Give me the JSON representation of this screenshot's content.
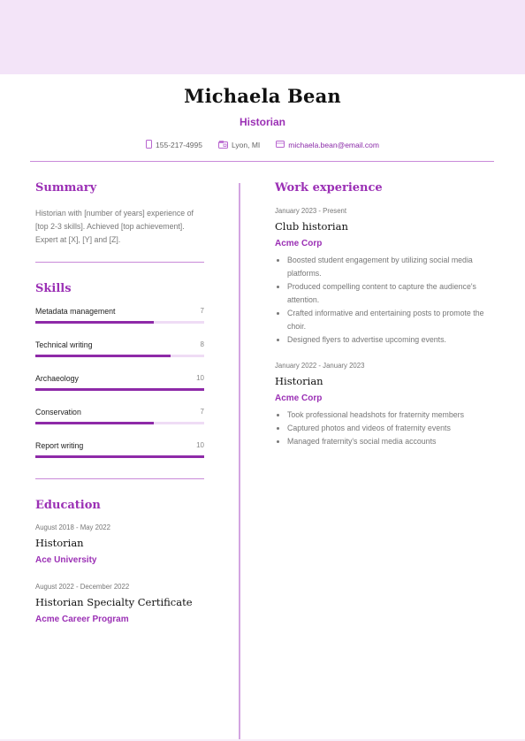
{
  "header": {
    "name": "Michaela Bean",
    "title": "Historian",
    "contacts": [
      {
        "icon": "phone-icon",
        "text": "155-217-4995"
      },
      {
        "icon": "location-card-icon",
        "text": "Lyon, MI"
      },
      {
        "icon": "email-icon",
        "text": "michaela.bean@email.com"
      }
    ]
  },
  "summary": {
    "heading": "Summary",
    "text": "Historian with [number of years] experience of [top 2-3 skills]. Achieved [top achievement]. Expert at [X], [Y] and [Z]."
  },
  "skills": {
    "heading": "Skills",
    "max": 10,
    "items": [
      {
        "name": "Metadata management",
        "level": 7
      },
      {
        "name": "Technical writing",
        "level": 8
      },
      {
        "name": "Archaeology",
        "level": 10
      },
      {
        "name": "Conservation",
        "level": 7
      },
      {
        "name": "Report writing",
        "level": 10
      }
    ]
  },
  "education": {
    "heading": "Education",
    "items": [
      {
        "dates": "August 2018 - May 2022",
        "degree": "Historian",
        "school": "Ace University"
      },
      {
        "dates": "August 2022 - December 2022",
        "degree": "Historian Specialty Certificate",
        "school": "Acme Career Program"
      }
    ]
  },
  "work": {
    "heading": "Work experience",
    "items": [
      {
        "dates": "January 2023 - Present",
        "role": "Club historian",
        "company": "Acme Corp",
        "bullets": [
          "Boosted student engagement by utilizing social media platforms.",
          "Produced compelling content to capture the audience's attention.",
          "Crafted informative and entertaining posts to promote the choir.",
          "Designed flyers to advertise upcoming events."
        ]
      },
      {
        "dates": "January 2022 - January 2023",
        "role": "Historian",
        "company": "Acme Corp",
        "bullets": [
          "Took professional headshots for fraternity members",
          "Captured photos and videos of fraternity events",
          "Managed fraternity's social media accounts"
        ]
      }
    ]
  },
  "colors": {
    "accent": "#9b30b5",
    "band": "#f3e4f8",
    "rule": "#c98ad9",
    "bar_fill": "#8e2aa8",
    "bar_track": "#efdcf5"
  }
}
